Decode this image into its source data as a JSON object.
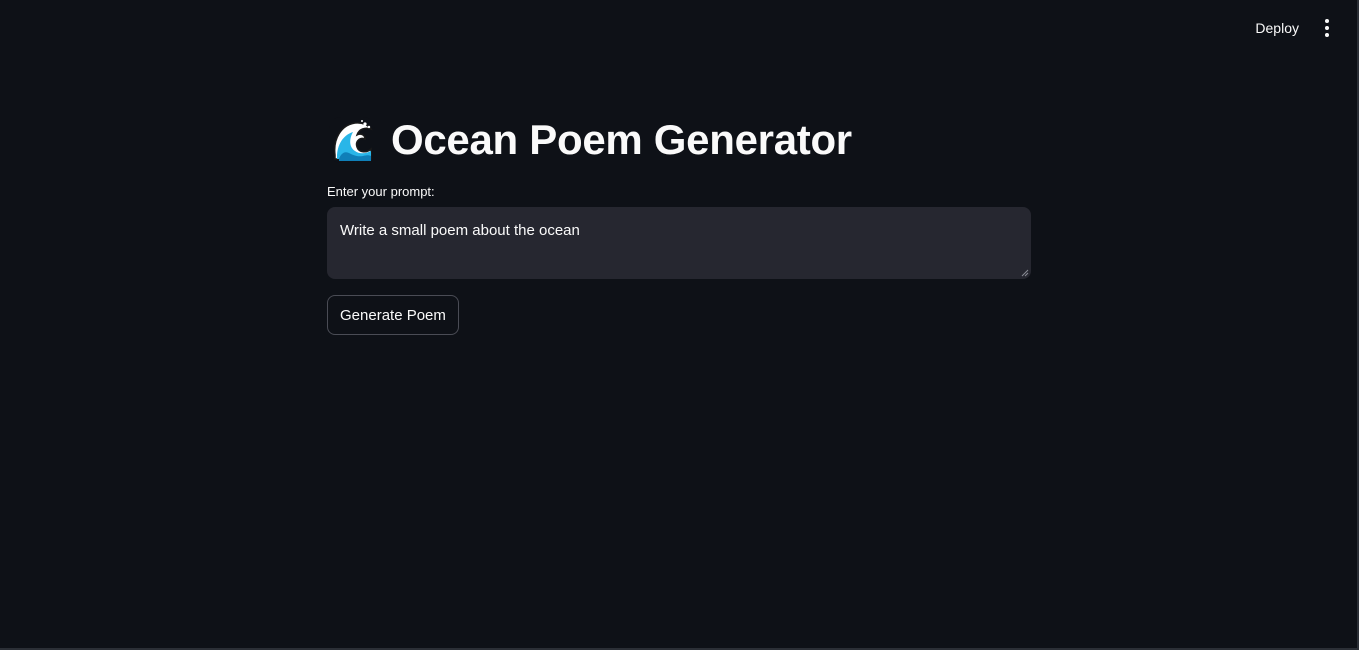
{
  "toolbar": {
    "deploy_label": "Deploy",
    "menu_icon": "kebab-menu-icon"
  },
  "main": {
    "title_icon": "water-wave-icon",
    "title": "Ocean Poem Generator",
    "prompt_label": "Enter your prompt:",
    "prompt_value": "Write a small poem about the ocean",
    "generate_label": "Generate Poem"
  },
  "colors": {
    "background": "#0e1117",
    "input_background": "#262730",
    "text": "#fafafa",
    "button_border": "#4a4c55"
  }
}
